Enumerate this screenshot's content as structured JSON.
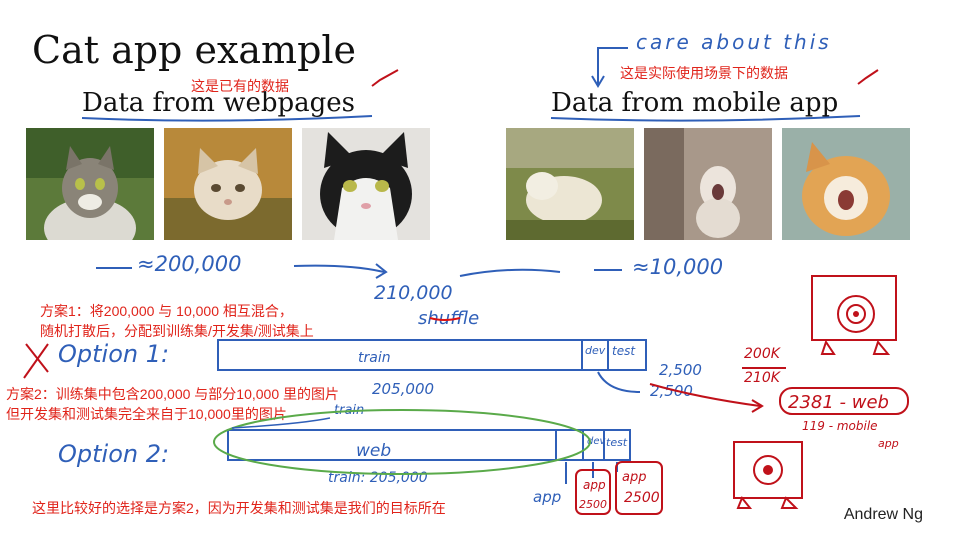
{
  "slide": {
    "title": "Cat app example",
    "author": "Andrew Ng"
  },
  "left_section": {
    "heading": "Data from webpages",
    "note_cn": "这是已有的数据",
    "count_label": "≈200,000"
  },
  "right_section": {
    "heading": "Data from mobile app",
    "note_cn": "这是实际使用场景下的数据",
    "handwritten_note": "care about this",
    "count_label": "≈10,000"
  },
  "middle": {
    "total": "210,000",
    "shuffle": "shuffle"
  },
  "option1": {
    "label": "Option 1:",
    "note_line1": "方案1：将200,000 与 10,000 相互混合，",
    "note_line2": "随机打散后，分配到训练集/开发集/测试集上",
    "train": "train",
    "dev": "dev",
    "test": "test",
    "dev_count": "2,500",
    "test_count": "2,500",
    "train_count": "205,000"
  },
  "option2": {
    "label": "Option 2:",
    "note_line1": "方案2：训练集中包含200,000 与部分10,000 里的图片",
    "note_line2": "但开发集和测试集完全来自于10,000里的图片",
    "train": "web",
    "train_label": "train",
    "dev": "dev",
    "test": "test",
    "train_count": "train: 205,000",
    "app_label": "app",
    "dev_app": "app",
    "dev_count": "2500",
    "test_app": "app",
    "test_count": "2500"
  },
  "right_notes": {
    "ratio_top": "200K",
    "ratio_bottom": "210K",
    "web_count": "2381 - web",
    "mobile_count": "119 - mobile",
    "mobile_suffix": "app"
  },
  "conclusion_cn": "这里比较好的选择是方案2，因为开发集和测试集是我们的目标所在",
  "colors": {
    "annotation_red": "#e0241b",
    "handwriting_blue": "#2f5fb8",
    "handwriting_red": "#c0111a",
    "highlight_green": "#5aaa4a"
  }
}
